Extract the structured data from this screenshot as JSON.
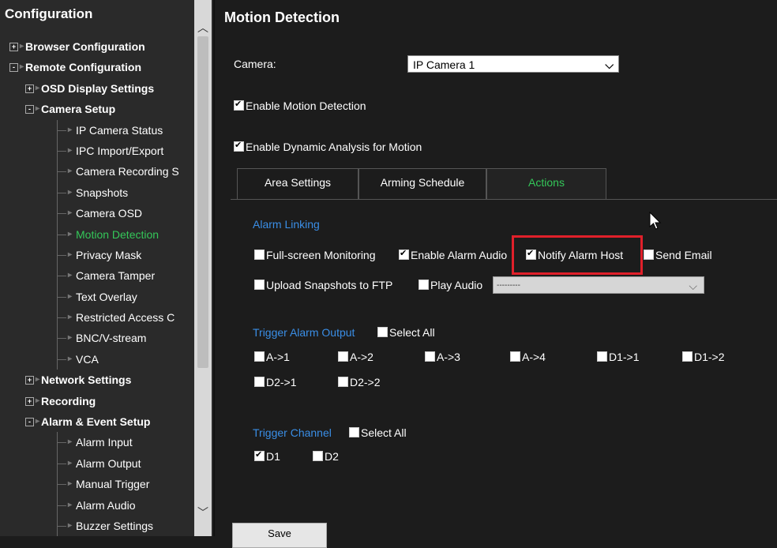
{
  "sidebar": {
    "title": "Configuration",
    "tree": [
      {
        "label": "Browser Configuration",
        "level": 1,
        "box": "+"
      },
      {
        "label": "Remote Configuration",
        "level": 1,
        "box": "-"
      },
      {
        "label": "OSD Display Settings",
        "level": 2,
        "box": "+"
      },
      {
        "label": "Camera Setup",
        "level": 2,
        "box": "-"
      },
      {
        "label": "IP Camera Status",
        "level": 3
      },
      {
        "label": "IPC Import/Export",
        "level": 3
      },
      {
        "label": "Camera Recording S",
        "level": 3
      },
      {
        "label": "Snapshots",
        "level": 3
      },
      {
        "label": "Camera OSD",
        "level": 3
      },
      {
        "label": "Motion Detection",
        "level": 3,
        "active": true
      },
      {
        "label": "Privacy Mask",
        "level": 3
      },
      {
        "label": "Camera Tamper",
        "level": 3
      },
      {
        "label": "Text Overlay",
        "level": 3
      },
      {
        "label": "Restricted Access C",
        "level": 3
      },
      {
        "label": "BNC/V-stream",
        "level": 3
      },
      {
        "label": "VCA",
        "level": 3
      },
      {
        "label": "Network Settings",
        "level": 2,
        "box": "+"
      },
      {
        "label": "Recording",
        "level": 2,
        "box": "+"
      },
      {
        "label": "Alarm & Event Setup",
        "level": 2,
        "box": "-"
      },
      {
        "label": "Alarm Input",
        "level": 3
      },
      {
        "label": "Alarm Output",
        "level": 3
      },
      {
        "label": "Manual Trigger",
        "level": 3
      },
      {
        "label": "Alarm Audio",
        "level": 3
      },
      {
        "label": "Buzzer Settings",
        "level": 3
      }
    ]
  },
  "main": {
    "title": "Motion Detection",
    "camera_label": "Camera:",
    "camera_value": "IP Camera 1",
    "enable_motion": {
      "label": "Enable Motion Detection",
      "checked": true
    },
    "enable_dynamic": {
      "label": "Enable Dynamic Analysis for Motion",
      "checked": true
    },
    "tabs": [
      {
        "label": "Area Settings",
        "active": false
      },
      {
        "label": "Arming Schedule",
        "active": false
      },
      {
        "label": "Actions",
        "active": true
      }
    ],
    "alarm_linking": {
      "title": "Alarm Linking",
      "full_screen": {
        "label": "Full-screen Monitoring",
        "checked": false
      },
      "alarm_audio": {
        "label": "Enable Alarm Audio",
        "checked": true
      },
      "notify_host": {
        "label": "Notify Alarm Host",
        "checked": true
      },
      "send_email": {
        "label": "Send Email",
        "checked": false
      },
      "upload_ftp": {
        "label": "Upload Snapshots to FTP",
        "checked": false
      },
      "play_audio": {
        "label": "Play Audio",
        "checked": false
      },
      "audio_select_value": "---------"
    },
    "trigger_output": {
      "title": "Trigger Alarm Output",
      "select_all": "Select All",
      "items": [
        "A->1",
        "A->2",
        "A->3",
        "A->4",
        "D1->1",
        "D1->2",
        "D2->1",
        "D2->2"
      ]
    },
    "trigger_channel": {
      "title": "Trigger Channel",
      "select_all": "Select All",
      "items": [
        {
          "label": "D1",
          "checked": true
        },
        {
          "label": "D2",
          "checked": false
        }
      ]
    },
    "save_label": "Save"
  },
  "colors": {
    "accent_green": "#34c759",
    "section_blue": "#3a8ee6",
    "highlight_red": "#e0202a"
  }
}
